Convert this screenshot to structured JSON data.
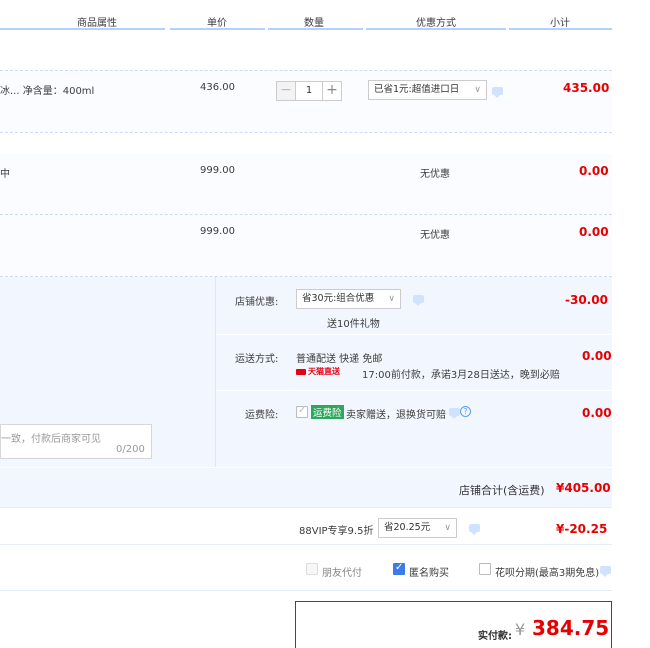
{
  "header": {
    "attributes": "商品属性",
    "unit_price": "单价",
    "quantity": "数量",
    "discount": "优惠方式",
    "subtotal": "小计"
  },
  "items": [
    {
      "attr": "冰...  净含量：400ml",
      "unit_price": "436.00",
      "quantity": "1",
      "discount_select": "已省1元:超值进口日",
      "subtotal": "435.00"
    },
    {
      "attr": "中",
      "unit_price": "999.00",
      "discount": "无优惠",
      "subtotal": "0.00"
    },
    {
      "unit_price": "999.00",
      "discount": "无优惠",
      "subtotal": "0.00"
    }
  ],
  "shop": {
    "discount_label": "店铺优惠:",
    "discount_select": "省30元:组合优惠",
    "gift_note": "送10件礼物",
    "discount_amount": "-30.00",
    "shipping_label": "运送方式:",
    "shipping_method": "普通配送 快递 免邮",
    "tmall_logo": "天猫直送",
    "shipping_note": "17:00前付款，承诺3月28日送达，晚到必赔",
    "shipping_amount": "0.00",
    "insurance_label": "运费险:",
    "insurance_badge": "运费险",
    "insurance_note": "卖家赠送，退换货可赔",
    "insurance_amount": "0.00",
    "message_placeholder": "一致，付款后商家可见",
    "message_count": "0/200",
    "total_label": "店铺合计(含运费)",
    "total_amount": "¥405.00"
  },
  "vip": {
    "label": "88VIP专享9.5折",
    "select": "省20.25元",
    "amount": "¥-20.25"
  },
  "options": {
    "friend_pay": "朋友代付",
    "anonymous": "匿名购买",
    "huabei": "花呗分期(最高3期免息)"
  },
  "payment": {
    "label": "实付款:",
    "currency": "¥",
    "amount": "384.75"
  },
  "colors": {
    "price_red": "#e60000",
    "accent_blue": "#3d7be8",
    "band_blue": "#f2f7ff"
  }
}
